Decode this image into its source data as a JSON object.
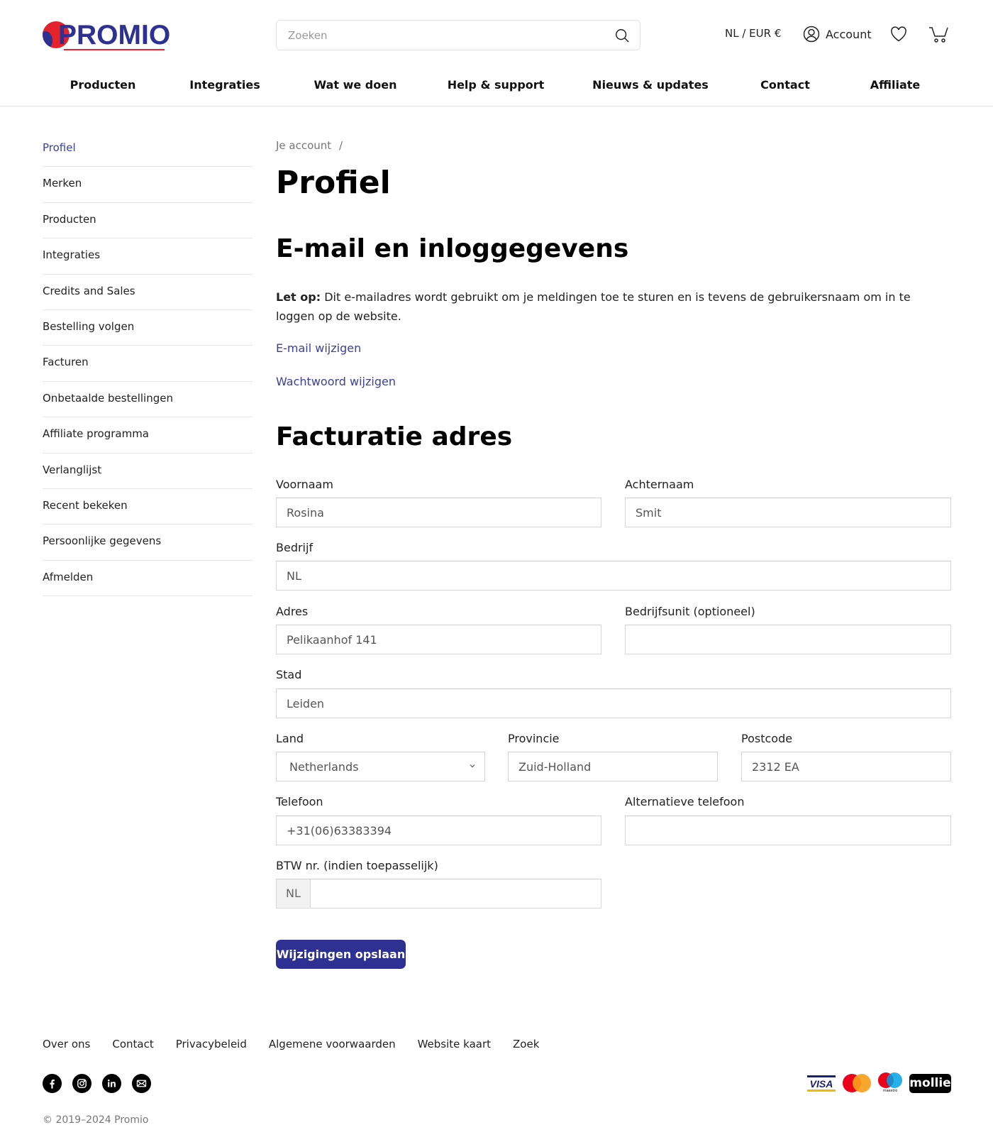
{
  "brand": {
    "name": "PROMIO",
    "primary_color": "#2e3192",
    "accent_color": "#e4232d"
  },
  "header": {
    "search_placeholder": "Zoeken",
    "search_value": "",
    "locale": "NL / EUR €",
    "account_label": "Account"
  },
  "nav": {
    "items": [
      {
        "label": "Producten"
      },
      {
        "label": "Integraties"
      },
      {
        "label": "Wat we doen"
      },
      {
        "label": "Help & support"
      },
      {
        "label": "Nieuws & updates"
      },
      {
        "label": "Contact"
      },
      {
        "label": "Affiliate"
      }
    ]
  },
  "sidebar": {
    "active_index": 0,
    "items": [
      {
        "label": "Profiel"
      },
      {
        "label": "Merken"
      },
      {
        "label": "Producten"
      },
      {
        "label": "Integraties"
      },
      {
        "label": "Credits and Sales"
      },
      {
        "label": "Bestelling volgen"
      },
      {
        "label": "Facturen"
      },
      {
        "label": "Onbetaalde bestellingen"
      },
      {
        "label": "Affiliate programma"
      },
      {
        "label": "Verlanglijst"
      },
      {
        "label": "Recent bekeken"
      },
      {
        "label": "Persoonlijke gegevens"
      },
      {
        "label": "Afmelden"
      }
    ]
  },
  "main": {
    "breadcrumb": {
      "label": "Je account",
      "separator": "/"
    },
    "title": "Profiel",
    "email_section": {
      "heading": "E-mail en inloggegevens",
      "note_bold": "Let op:",
      "note_text": " Dit e-mailadres wordt gebruikt om je meldingen toe te sturen en is tevens de gebruikersnaam om in te loggen op de website.",
      "change_email": "E-mail wijzigen",
      "change_password": "Wachtwoord wijzigen"
    },
    "billing": {
      "heading": "Facturatie adres",
      "fields": {
        "first_name": {
          "label": "Voornaam",
          "value": "Rosina"
        },
        "last_name": {
          "label": "Achternaam",
          "value": "Smit"
        },
        "company": {
          "label": "Bedrijf",
          "value": "NL"
        },
        "address": {
          "label": "Adres",
          "value": "Pelikaanhof 141"
        },
        "unit": {
          "label": "Bedrijfsunit (optioneel)",
          "value": ""
        },
        "city": {
          "label": "Stad",
          "value": "Leiden"
        },
        "country": {
          "label": "Land",
          "value": "Netherlands"
        },
        "province": {
          "label": "Provincie",
          "value": "Zuid-Holland"
        },
        "postcode": {
          "label": "Postcode",
          "value": "2312 EA"
        },
        "phone": {
          "label": "Telefoon",
          "value": "+31(06)63383394"
        },
        "alt_phone": {
          "label": "Alternatieve telefoon",
          "value": ""
        },
        "vat": {
          "label": "BTW nr. (indien toepasselijk)",
          "prefix": "NL",
          "value": ""
        }
      },
      "save_label": "Wijzigingen opslaan"
    }
  },
  "footer": {
    "links": [
      {
        "label": "Over ons"
      },
      {
        "label": "Contact"
      },
      {
        "label": "Privacybeleid"
      },
      {
        "label": "Algemene voorwaarden"
      },
      {
        "label": "Website kaart"
      },
      {
        "label": "Zoek"
      }
    ],
    "social": [
      "facebook-icon",
      "instagram-icon",
      "linkedin-icon",
      "email-icon"
    ],
    "copyright": "© 2019–2024 Promio",
    "payments": {
      "visa": "VISA",
      "maestro": "maestro",
      "mollie": "mollie"
    }
  }
}
